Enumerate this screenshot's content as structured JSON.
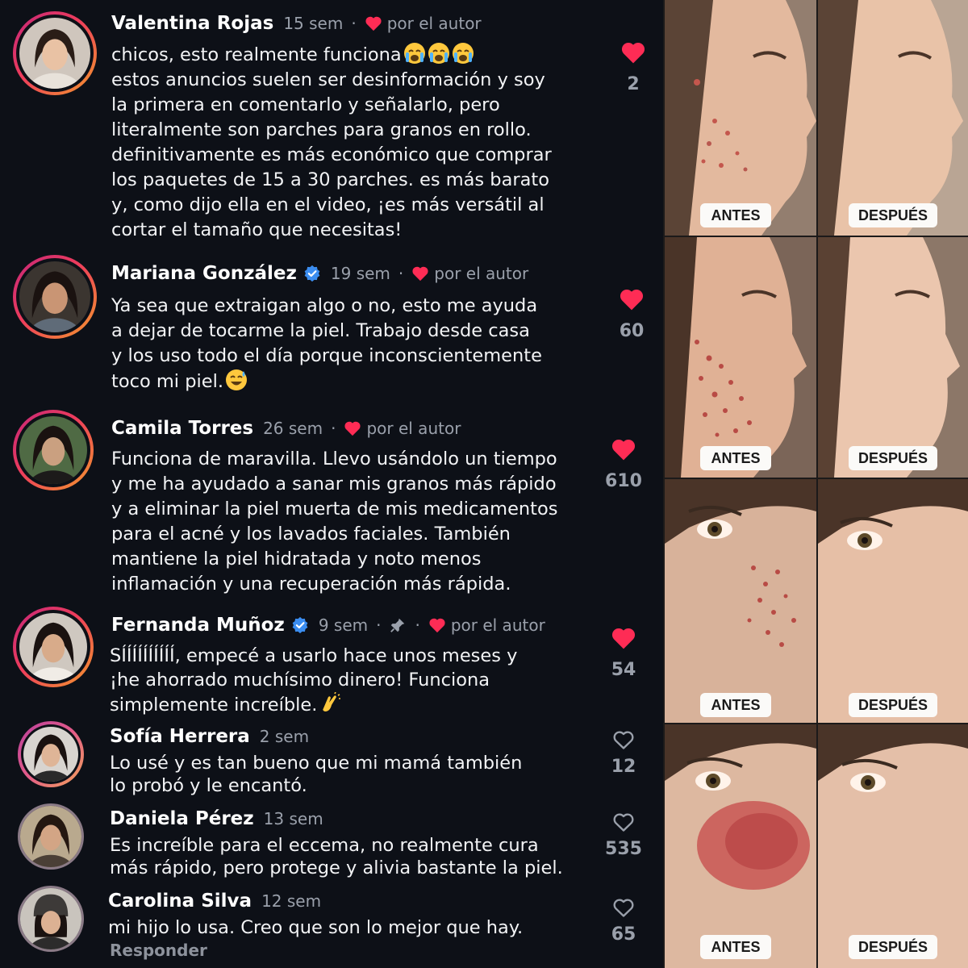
{
  "comments": [
    {
      "name": "Valentina Rojas",
      "time": "15 sem",
      "by_author": "por el autor",
      "text": "chicos, esto realmente funciona",
      "text_rest": "estos anuncios suelen ser desinformación y soy\nla primera en comentarlo y señalarlo, pero\nliteralmente son parches para granos en rollo.\ndefinitivamente es más económico que comprar\nlos paquetes de 15 a 30 parches. es más barato\ny, como dijo ella en el video, ¡es más versátil al\ncortar el tamaño que necesitas!",
      "emoji": "loudly-crying-face x3",
      "likes": "2"
    },
    {
      "name": "Mariana González",
      "verified": true,
      "time": "19 sem",
      "by_author": "por el autor",
      "text": "Ya sea que extraigan algo o no, esto me ayuda\na dejar de tocarme la piel. Trabajo desde casa\ny los uso todo el día porque inconscientemente\ntoco mi piel.",
      "emoji": "grinning-sweat-face",
      "likes": "60"
    },
    {
      "name": "Camila Torres",
      "time": "26 sem",
      "by_author": "por el autor",
      "text": "Funciona de maravilla. Llevo usándolo un tiempo\ny me ha ayudado a sanar mis granos más rápido\ny a eliminar la piel muerta de mis medicamentos\npara el acné y los lavados faciales. También\nmantiene la piel hidratada y noto menos\ninflamación y una recuperación más rápida.",
      "likes": "610"
    },
    {
      "name": "Fernanda Muñoz",
      "verified": true,
      "pinned": true,
      "time": "9 sem",
      "by_author": "por el autor",
      "text": "SÍÍÍÍÍÍÍÍÍÍ, empecé a usarlo hace unos meses y\n¡he ahorrado muchísimo dinero! Funciona\nsimplemente increíble.",
      "emoji": "clapping-hands",
      "likes": "54"
    },
    {
      "name": "Sofía Herrera",
      "time": "2 sem",
      "text": "Lo usé y es tan bueno que mi mamá también\nlo probó y le encantó.",
      "likes": "12"
    },
    {
      "name": "Daniela Pérez",
      "time": "13 sem",
      "text": "Es increíble para el eccema, no realmente cura\nmás rápido, pero protege y alivia bastante la piel.",
      "likes": "535"
    },
    {
      "name": "Carolina Silva",
      "time": "12 sem",
      "text": "mi hijo lo usa. Creo que son lo mejor que hay.",
      "likes": "65"
    }
  ],
  "reply_label": "Responder",
  "before_label": "ANTES",
  "after_label": "DESPUÉS",
  "colors": {
    "background": "#0d1017",
    "like_red": "#fe2c55",
    "muted": "#9aa0ab",
    "verified_blue": "#3b8df0"
  }
}
